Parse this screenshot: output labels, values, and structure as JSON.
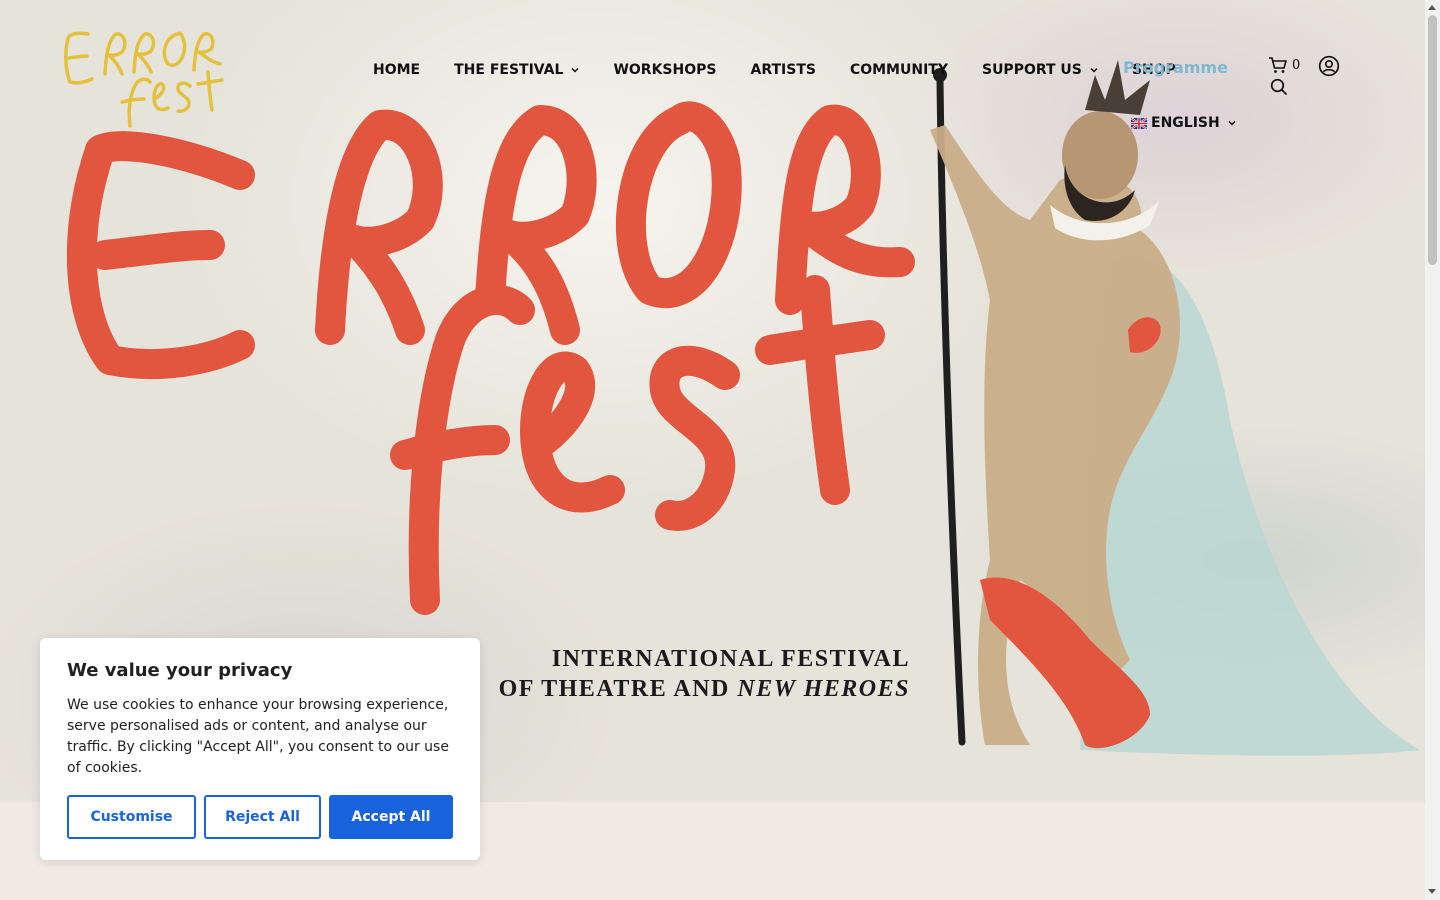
{
  "site": {
    "logo_text": "Error fest"
  },
  "nav": {
    "items": [
      {
        "label": "HOME",
        "has_dropdown": false
      },
      {
        "label": "THE FESTIVAL",
        "has_dropdown": true
      },
      {
        "label": "WORKSHOPS",
        "has_dropdown": false
      },
      {
        "label": "ARTISTS",
        "has_dropdown": false
      },
      {
        "label": "COMMUNITY",
        "has_dropdown": false
      },
      {
        "label": "SUPPORT US",
        "has_dropdown": true
      },
      {
        "label": "SHOP",
        "has_dropdown": false
      }
    ],
    "programme_label": "Programme",
    "cart_count": "0",
    "language": "ENGLISH"
  },
  "hero": {
    "tagline_line1": "INTERNATIONAL FESTIVAL",
    "tagline_line2_prefix": "OF THEATRE AND ",
    "tagline_line2_emph": "NEW HEROES"
  },
  "cookie": {
    "title": "We value your privacy",
    "body": "We use cookies to enhance your browsing experience, serve personalised ads or content, and analyse our traffic. By clicking \"Accept All\", you consent to our use of cookies.",
    "customise_label": "Customise",
    "reject_label": "Reject All",
    "accept_label": "Accept All"
  },
  "colors": {
    "logo_yellow": "#e3c13d",
    "title_red": "#e2553f",
    "programme_blue": "#7fb8cf",
    "cookie_blue": "#1863dc"
  }
}
